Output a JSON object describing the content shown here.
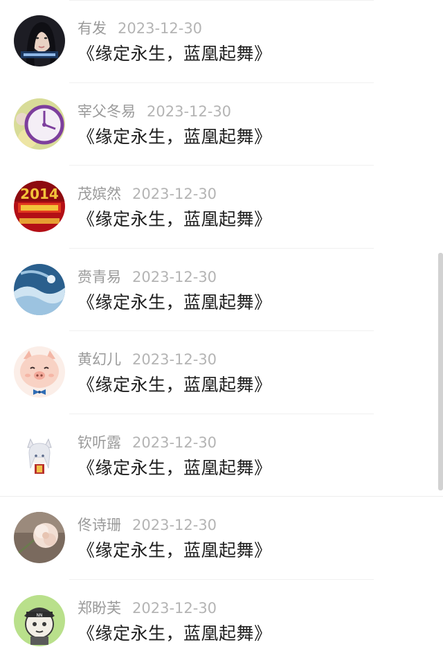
{
  "comments": [
    {
      "author": "有发",
      "date": "2023-12-30",
      "title": "《缘定永生，蓝凰起舞》",
      "avatar": "woman-portrait-avatar",
      "colors": [
        "#1d1d24",
        "#e9d2c4"
      ]
    },
    {
      "author": "宰父冬易",
      "date": "2023-12-30",
      "title": "《缘定永生，蓝凰起舞》",
      "avatar": "clock-avatar",
      "colors": [
        "#c7d38a",
        "#7d3f9d"
      ]
    },
    {
      "author": "茂嫔然",
      "date": "2023-12-30",
      "title": "《缘定永生，蓝凰起舞》",
      "avatar": "new-year-2014-avatar",
      "colors": [
        "#b30f16",
        "#f3c33a"
      ]
    },
    {
      "author": "赍青易",
      "date": "2023-12-30",
      "title": "《缘定永生，蓝凰起舞》",
      "avatar": "blue-water-avatar",
      "colors": [
        "#2a5f8d",
        "#cfe4f2"
      ]
    },
    {
      "author": "黄幻儿",
      "date": "2023-12-30",
      "title": "《缘定永生，蓝凰起舞》",
      "avatar": "pig-avatar",
      "colors": [
        "#f8d2c4",
        "#2f6db5"
      ]
    },
    {
      "author": "钦听露",
      "date": "2023-12-30",
      "title": "《缘定永生，蓝凰起舞》",
      "avatar": "anime-girl-avatar",
      "colors": [
        "#ffffff",
        "#c8ccd8"
      ]
    },
    {
      "author": "佟诗珊",
      "date": "2023-12-30",
      "title": "《缘定永生，蓝凰起舞》",
      "avatar": "flower-avatar",
      "colors": [
        "#7a6a5e",
        "#f2dfd4"
      ]
    },
    {
      "author": "郑盼芙",
      "date": "2023-12-30",
      "title": "《缘定永生，蓝凰起舞》",
      "avatar": "cartoon-boy-avatar",
      "colors": [
        "#b9e08b",
        "#3a3a3a"
      ]
    }
  ]
}
